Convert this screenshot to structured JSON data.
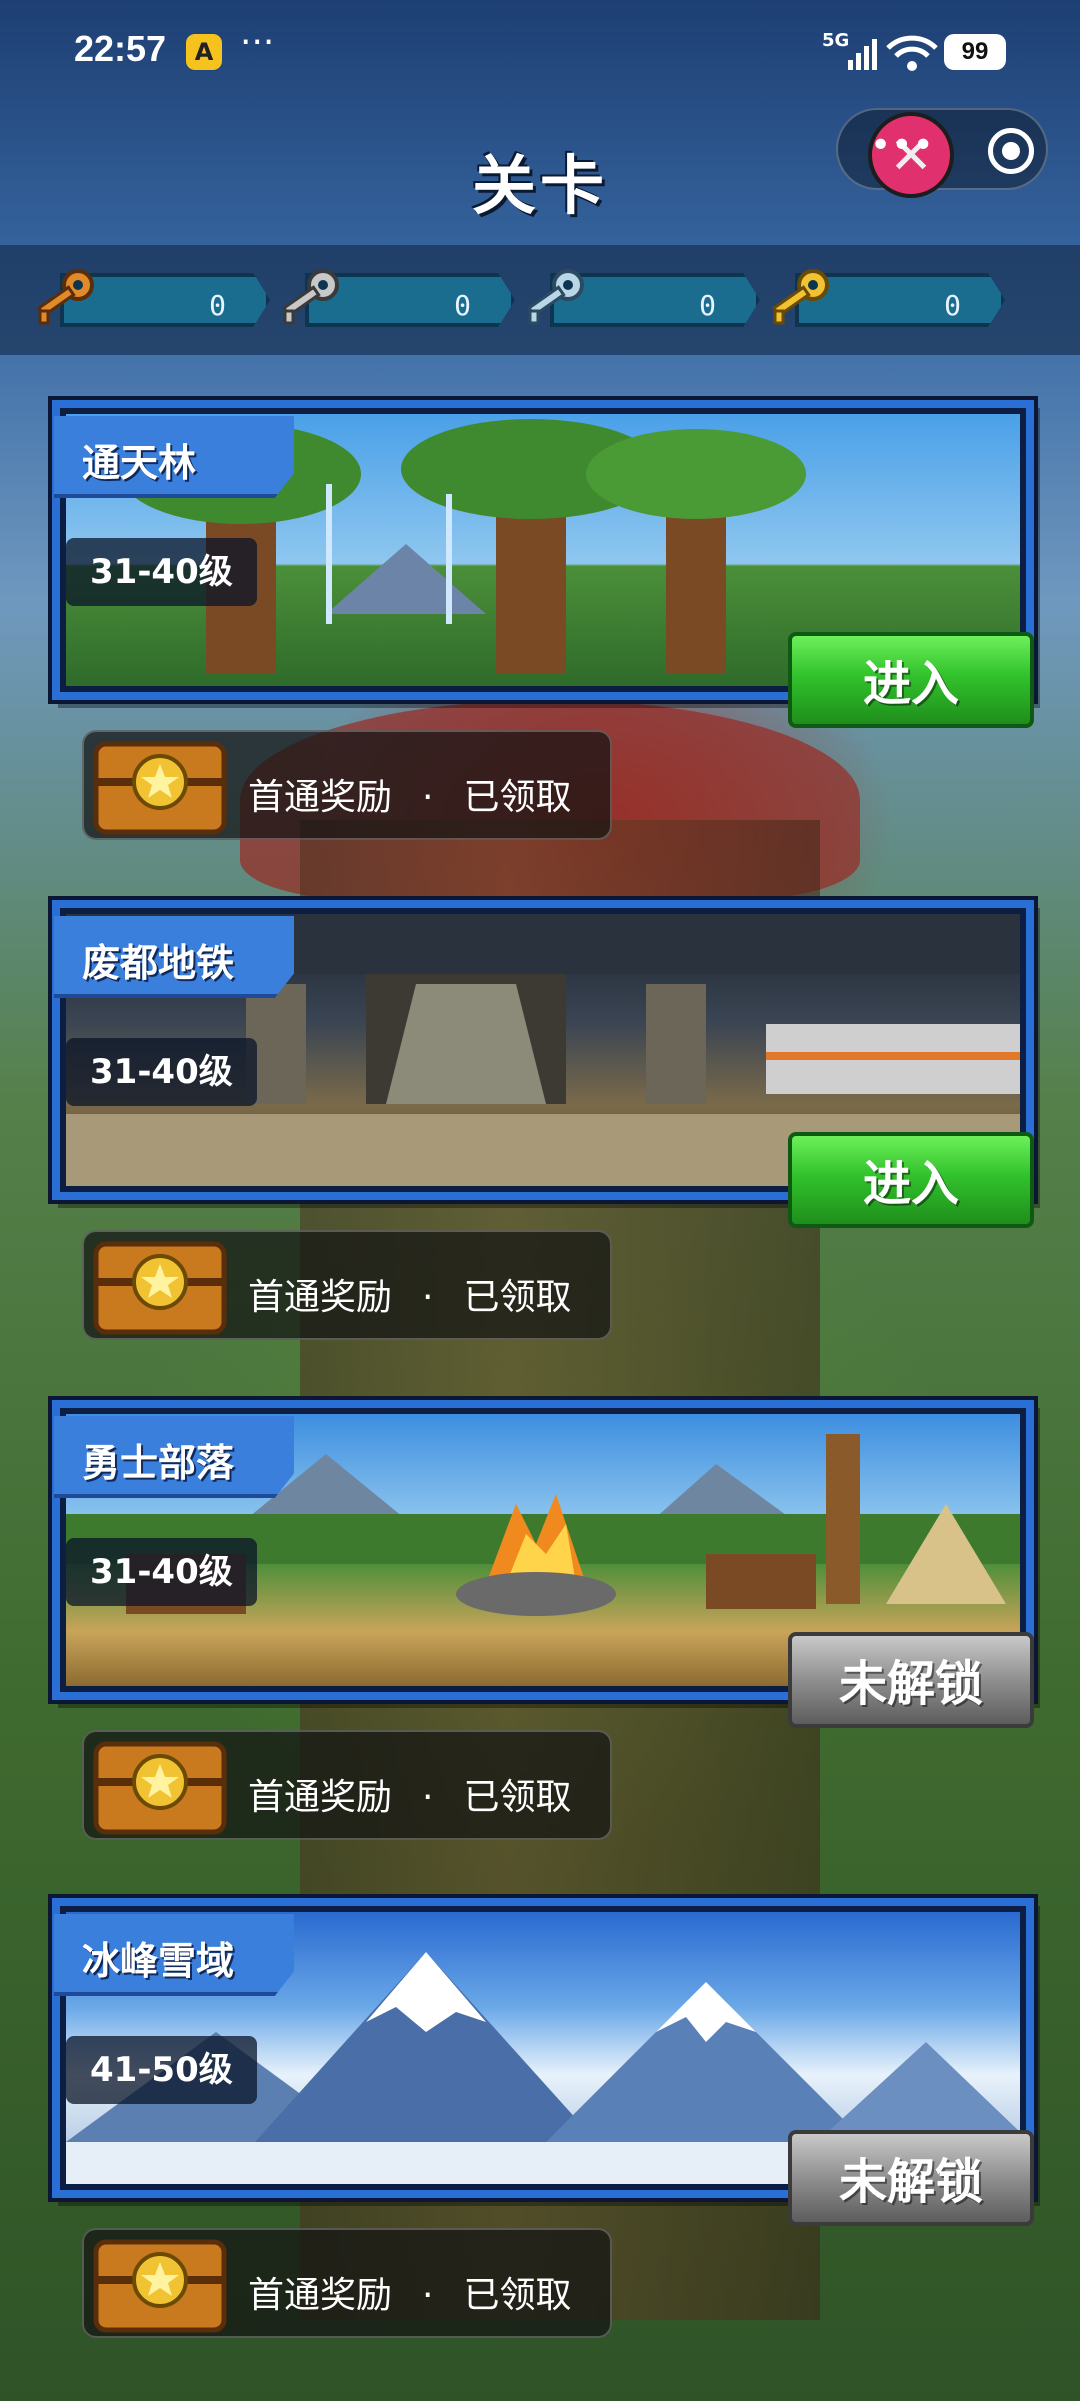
{
  "status_bar": {
    "time": "22:57",
    "app_icon": "A",
    "more": "···",
    "network": "5G",
    "battery": "99"
  },
  "header": {
    "title": "关卡",
    "capsule_more": "•••"
  },
  "keys": [
    {
      "name": "bronze-key",
      "count": "0",
      "color": "#e08a2a"
    },
    {
      "name": "silver-key",
      "count": "0",
      "color": "#c8c8c8"
    },
    {
      "name": "platinum-key",
      "count": "0",
      "color": "#b9d7e8"
    },
    {
      "name": "gold-key",
      "count": "0",
      "color": "#f1c232"
    }
  ],
  "levels": [
    {
      "name": "通天林",
      "range": "31-40级",
      "action": "进入",
      "locked": false,
      "reward_label": "首通奖励",
      "reward_sep": "·",
      "reward_status": "已领取"
    },
    {
      "name": "废都地铁",
      "range": "31-40级",
      "action": "进入",
      "locked": false,
      "reward_label": "首通奖励",
      "reward_sep": "·",
      "reward_status": "已领取"
    },
    {
      "name": "勇士部落",
      "range": "31-40级",
      "action": "未解锁",
      "locked": true,
      "reward_label": "首通奖励",
      "reward_sep": "·",
      "reward_status": "已领取"
    },
    {
      "name": "冰峰雪域",
      "range": "41-50级",
      "action": "未解锁",
      "locked": true,
      "reward_label": "首通奖励",
      "reward_sep": "·",
      "reward_status": "已领取"
    }
  ],
  "colors": {
    "enter_green": "#31c22c",
    "locked_gray": "#8f8f8f",
    "frame_blue": "#2a6fd6"
  }
}
